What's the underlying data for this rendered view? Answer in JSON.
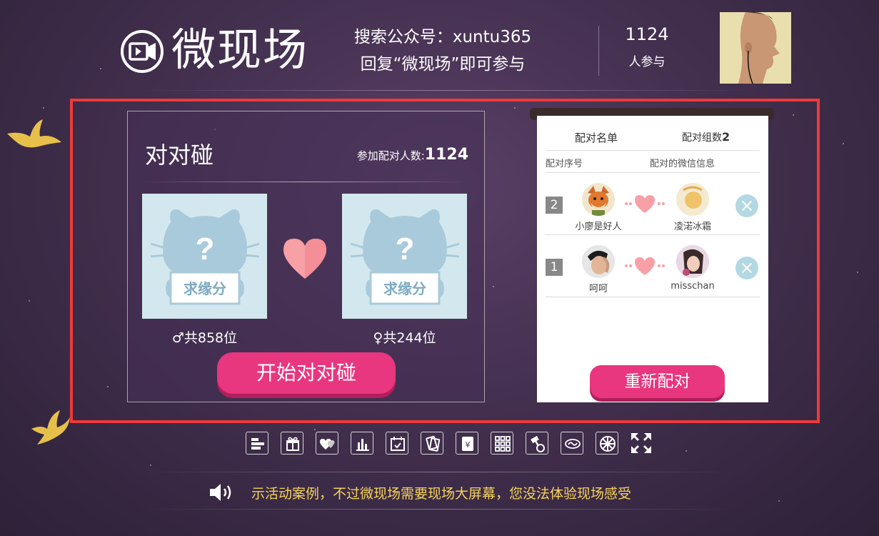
{
  "header": {
    "logo_text": "微现场",
    "search_line": "搜索公众号：xuntu365",
    "reply_line": "回复“微现场”即可参与",
    "participant_count": "1124",
    "participant_label": "人参与"
  },
  "game": {
    "title": "对对碰",
    "count_label": "参加配对人数:",
    "count_value": "1124",
    "card_text": "求缘分",
    "male_count": "♂共858位",
    "female_count": "♀共244位",
    "start_button": "开始对对碰"
  },
  "pair_list": {
    "title": "配对名单",
    "groups_label": "配对组数",
    "groups_value": "2",
    "col_number": "配对序号",
    "col_info": "配对的微信信息",
    "pairs": [
      {
        "num": "2",
        "left_name": "小廖是好人",
        "right_name": "凌渃冰霜"
      },
      {
        "num": "1",
        "left_name": "呵呵",
        "right_name": "misschan"
      }
    ],
    "repair_button": "重新配对"
  },
  "toolbar": {
    "icons": [
      "ranking-icon",
      "gift-icon",
      "hearts-icon",
      "chart-icon",
      "calendar-icon",
      "cards-icon",
      "money-icon",
      "grid-icon",
      "hammer-icon",
      "brand-icon",
      "wheel-icon",
      "fullscreen-icon"
    ]
  },
  "footer": {
    "marquee_text": "示活动案例，不过微现场需要现场大屏幕，您没法体验现场感受"
  },
  "colors": {
    "accent_pink": "#e8367f",
    "highlight_red": "#ee3a3a",
    "card_blue": "#d3e8ee",
    "marquee_yellow": "#f6d35a"
  }
}
